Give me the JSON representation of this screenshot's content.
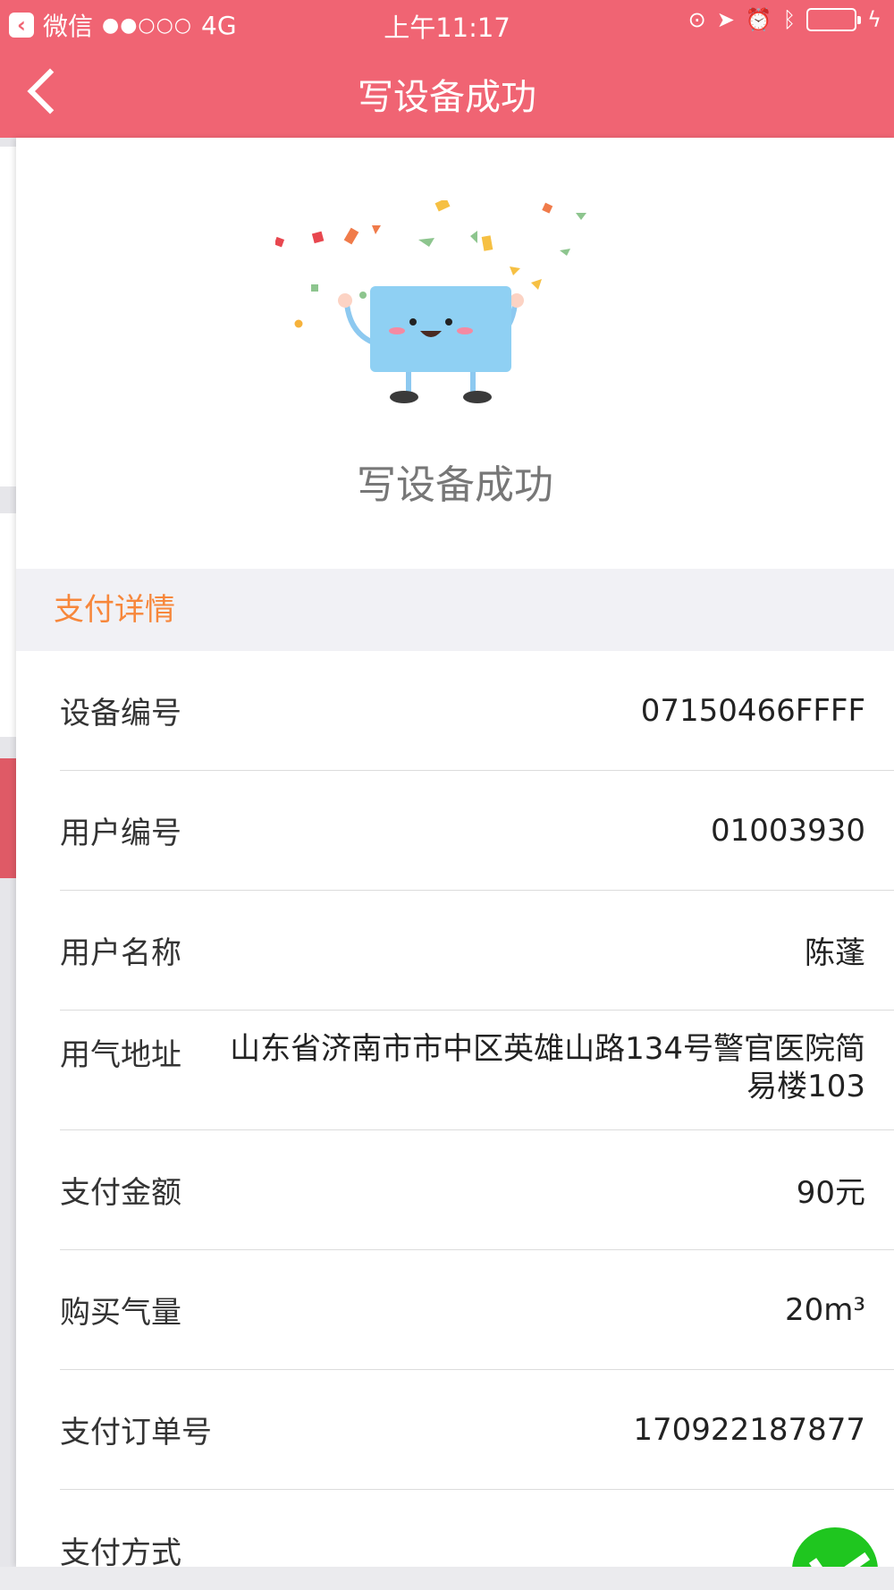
{
  "status_bar": {
    "carrier": "微信",
    "signal": "●●○○○",
    "network": "4G",
    "time": "上午11:17"
  },
  "nav": {
    "title": "写设备成功"
  },
  "hero": {
    "title": "写设备成功"
  },
  "section": {
    "title": "支付详情"
  },
  "details": [
    {
      "label": "设备编号",
      "value": "07150466FFFF"
    },
    {
      "label": "用户编号",
      "value": "01003930"
    },
    {
      "label": "用户名称",
      "value": "陈蓬"
    },
    {
      "label": "用气地址",
      "value": "山东省济南市市中区英雄山路134号警官医院简易楼103"
    },
    {
      "label": "支付金额",
      "value": "90元"
    },
    {
      "label": "购买气量",
      "value": "20m³"
    },
    {
      "label": "支付订单号",
      "value": "170922187877"
    },
    {
      "label": "支付方式",
      "value": ""
    }
  ],
  "colors": {
    "brand": "#f06473",
    "section_accent": "#f7873b",
    "wechat_green": "#1fc61f"
  }
}
